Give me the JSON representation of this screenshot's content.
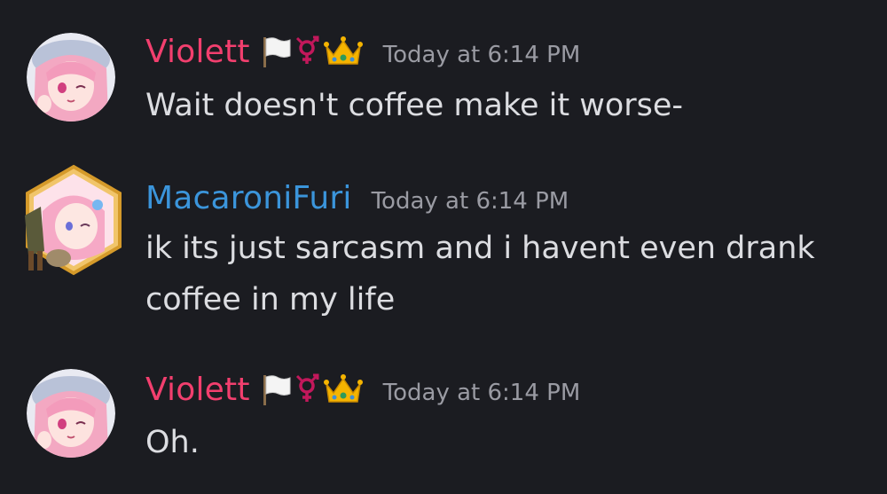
{
  "messages": [
    {
      "username": "Violett",
      "username_color": "#f23f6e",
      "timestamp": "Today at 6:14 PM",
      "badges": [
        "white-flag-icon",
        "transgender-symbol-icon",
        "crown-icon"
      ],
      "lines": [
        "Wait doesn't coffee make it worse-"
      ]
    },
    {
      "username": "MacaroniFuri",
      "username_color": "#3b95db",
      "timestamp": "Today at 6:14 PM",
      "badges": [],
      "lines": [
        "ik its just sarcasm and i havent even drank",
        "coffee in my life"
      ]
    },
    {
      "username": "Violett",
      "username_color": "#f23f6e",
      "timestamp": "Today at 6:14 PM",
      "badges": [
        "white-flag-icon",
        "transgender-symbol-icon",
        "crown-icon"
      ],
      "lines": [
        "Oh."
      ]
    }
  ],
  "colors": {
    "background": "#1b1c21",
    "message_text": "#dcdde1",
    "timestamp": "#9a9ba3"
  }
}
